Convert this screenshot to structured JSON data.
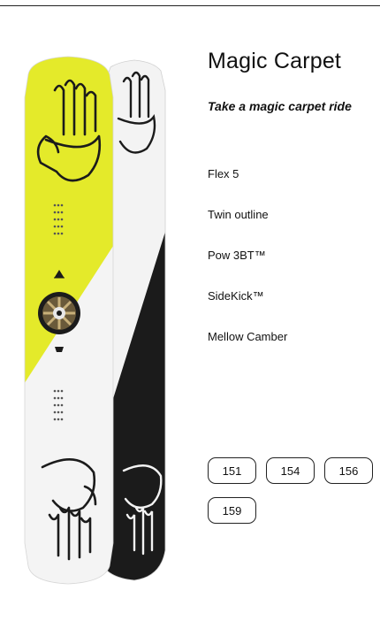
{
  "product": {
    "title": "Magic Carpet",
    "tagline": "Take a magic carpet ride"
  },
  "features": [
    "Flex 5",
    "Twin outline",
    "Pow 3BT™",
    "SideKick™",
    "Mellow Camber"
  ],
  "sizes": [
    "151",
    "154",
    "156",
    "159"
  ],
  "colors": {
    "board_yellow": "#e4ea2a",
    "board_black": "#1b1b1b",
    "board_white": "#f3f3f3"
  }
}
